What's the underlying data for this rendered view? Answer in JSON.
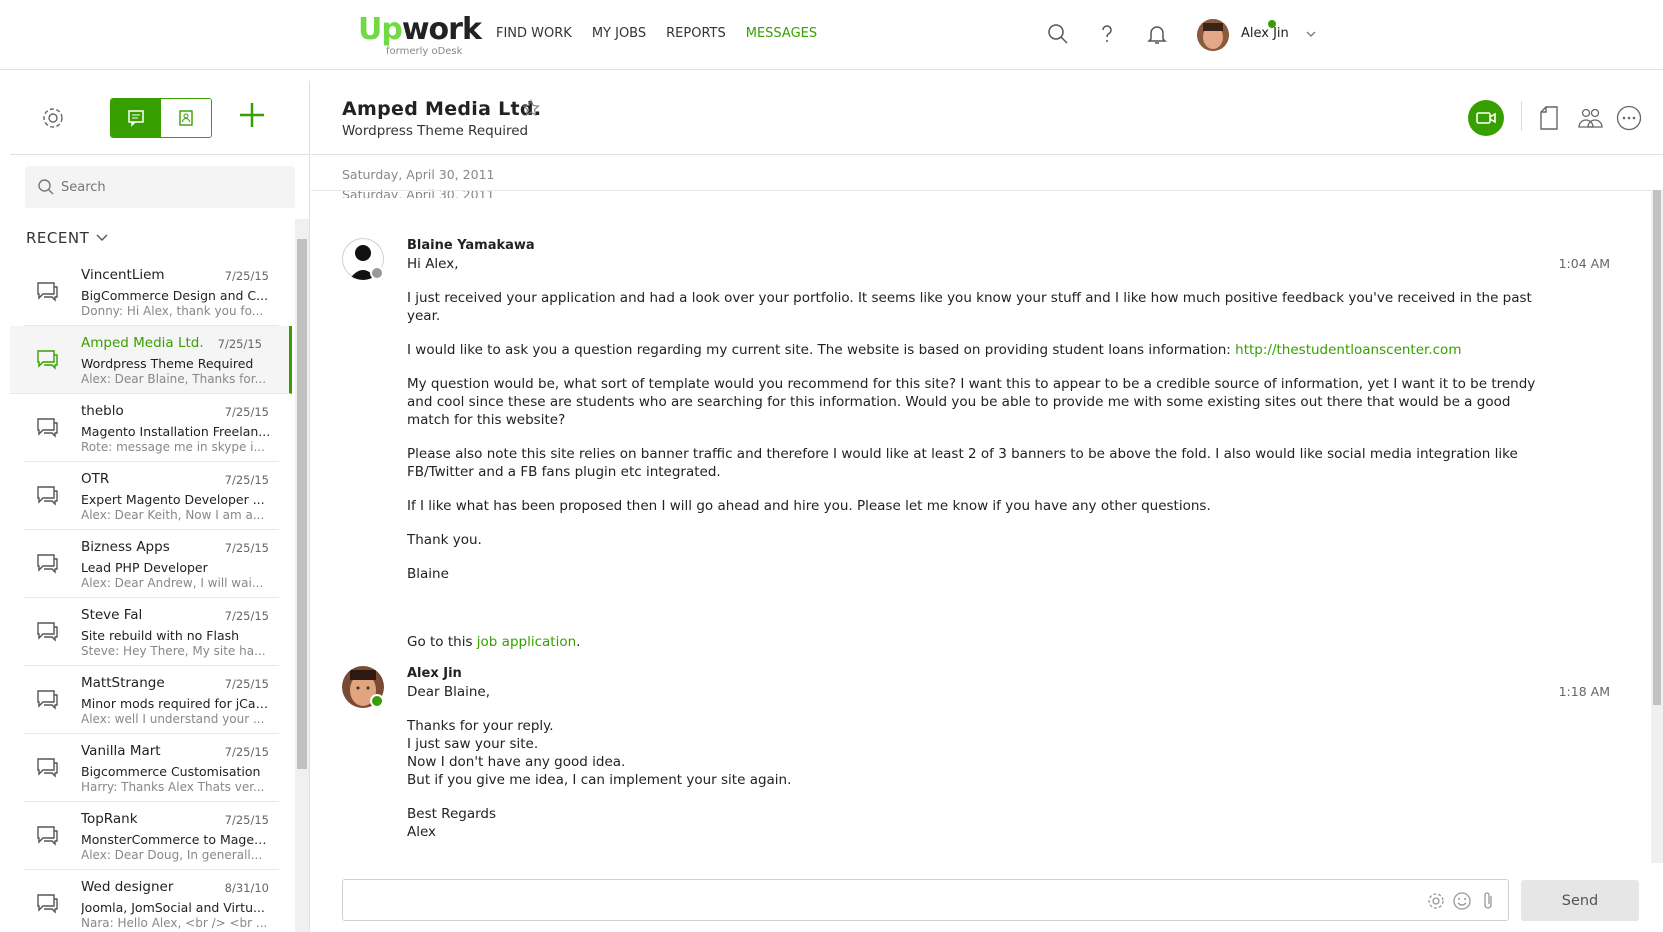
{
  "brand": {
    "logo_up": "Up",
    "logo_rest": "work",
    "logo_sub": "formerly oDesk"
  },
  "nav": {
    "links": [
      "FIND WORK",
      "MY JOBS",
      "REPORTS",
      "MESSAGES"
    ],
    "active": "MESSAGES",
    "icons": [
      "search-icon",
      "help-icon",
      "bell-icon"
    ],
    "user_name": "Alex Jin",
    "user_status_color": "#37a000"
  },
  "sidebar": {
    "search_placeholder": "Search",
    "recent_label": "RECENT",
    "conversations": [
      {
        "name": "VincentLiem",
        "date": "7/25/15",
        "subject": "BigCommerce Design and C...",
        "preview": "Donny: Hi Alex, thank you fo...",
        "selected": false
      },
      {
        "name": "Amped Media Ltd.",
        "date": "7/25/15",
        "subject": "Wordpress Theme Required",
        "preview": "Alex: Dear Blaine, Thanks for...",
        "selected": true
      },
      {
        "name": "theblo",
        "date": "7/25/15",
        "subject": "Magento Installation Freelan...",
        "preview": "Rote: message me in skype i...",
        "selected": false
      },
      {
        "name": "OTR",
        "date": "7/25/15",
        "subject": "Expert Magento Developer ...",
        "preview": "Alex: Dear Keith, Now I am a...",
        "selected": false
      },
      {
        "name": "Bizness Apps",
        "date": "7/25/15",
        "subject": "Lead PHP Developer",
        "preview": "Alex: Dear Andrew, I will wai...",
        "selected": false
      },
      {
        "name": "Steve Fal",
        "date": "7/25/15",
        "subject": "Site rebuild with no Flash",
        "preview": "Steve: Hey There, My site ha...",
        "selected": false
      },
      {
        "name": "MattStrange",
        "date": "7/25/15",
        "subject": "Minor mods required for jCar...",
        "preview": "Alex: well I understand your ...",
        "selected": false
      },
      {
        "name": "Vanilla Mart",
        "date": "7/25/15",
        "subject": "Bigcommerce Customisation",
        "preview": "Harry: Thanks Alex Thats ver...",
        "selected": false
      },
      {
        "name": "TopRank",
        "date": "7/25/15",
        "subject": "MonsterCommerce to Magen...",
        "preview": "Alex: Dear Doug, In generall...",
        "selected": false
      },
      {
        "name": "Wed designer",
        "date": "8/31/10",
        "subject": "Joomla, JomSocial and Virtu...",
        "preview": "Nara: Hello Alex, <br /> <br ...",
        "selected": false
      }
    ]
  },
  "chat": {
    "title": "Amped Media Ltd.",
    "subtitle": "Wordpress Theme Required",
    "date_label": "Saturday, April 30, 2011",
    "date_label_dup": "Saturday, April 30, 2011",
    "accent_color": "#37a000",
    "messages": [
      {
        "sender": "Blaine Yamakawa",
        "time": "1:04 AM",
        "greeting": "Hi Alex,",
        "p1": "I just received your application and had a look over your portfolio. It seems like you know your stuff and I like how much positive feedback you've received in the past year.",
        "p2": "I would like to ask you a question regarding my current site. The website is based on providing student loans information:",
        "p2_link": "http://thestudentloanscenter.com",
        "p3": "My question would be, what sort of template would you recommend for this site? I want this to appear to be a credible source of information, yet I want it to be trendy and cool since these are students who are searching for this information. Would you be able to provide me with some existing sites out there that would be a good match for this website?",
        "p4": "Please also note this site relies on banner traffic and therefore I would like at least 2 of 3 banners to be above the fold. I also would like social media integration like FB/Twitter and a FB fans plugin etc integrated.",
        "p5": "If I like what has been proposed then I will go ahead and hire you. Please let me know if you have any other questions.",
        "p6": "Thank you.",
        "p7": "Blaine",
        "footer": "Go to this",
        "footer_link": "job application",
        "footer_end": "."
      },
      {
        "sender": "Alex Jin",
        "time": "1:18 AM",
        "greeting": "Dear Blaine,",
        "l1": "Thanks for your reply.",
        "l2": "I just saw your site.",
        "l3": "Now I don't have any good idea.",
        "l4": "But if you give me idea, I can implement your site again.",
        "l5": "Best Regards",
        "l6": "Alex"
      }
    ]
  },
  "compose": {
    "value": "",
    "send_label": "Send"
  }
}
